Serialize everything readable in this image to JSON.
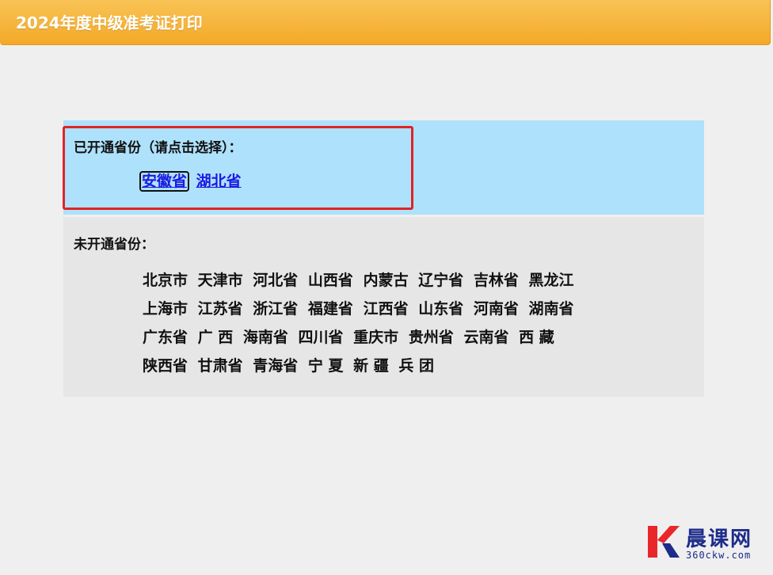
{
  "header": {
    "title": "2024年度中级准考证打印"
  },
  "open_section": {
    "title": "已开通省份（请点击选择）：",
    "provinces": [
      "安徽省",
      "湖北省"
    ],
    "selected": "安徽省"
  },
  "closed_section": {
    "title": "未开通省份：",
    "rows": [
      [
        "北京市",
        "天津市",
        "河北省",
        "山西省",
        "内蒙古",
        "辽宁省",
        "吉林省",
        "黑龙江"
      ],
      [
        "上海市",
        "江苏省",
        "浙江省",
        "福建省",
        "江西省",
        "山东省",
        "河南省",
        "湖南省"
      ],
      [
        "广东省",
        "广 西",
        "海南省",
        "四川省",
        "重庆市",
        "贵州省",
        "云南省",
        "西 藏"
      ],
      [
        "陕西省",
        "甘肃省",
        "青海省",
        "宁 夏",
        "新 疆",
        "兵 团"
      ]
    ]
  },
  "watermark": {
    "name": "晨课网",
    "url": "360ckw.com"
  },
  "colors": {
    "header": "#f5b03a",
    "open_bg": "#aee1fb",
    "closed_bg": "#e6e6e6",
    "link": "#1a1ae0",
    "highlight": "#e02424"
  }
}
